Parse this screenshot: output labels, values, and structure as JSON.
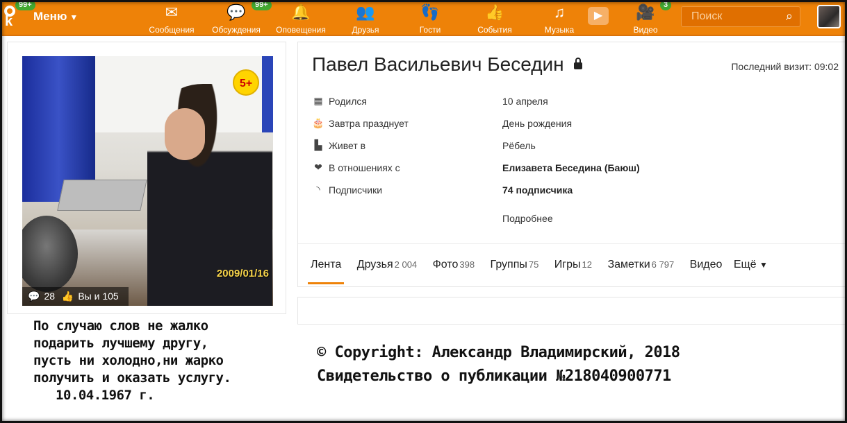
{
  "topbar": {
    "logo_badge": "99+",
    "menu_label": "Меню",
    "nav": [
      {
        "label": "Сообщения",
        "icon": "envelope-icon"
      },
      {
        "label": "Обсуждения",
        "icon": "chat-icon",
        "badge": "99+"
      },
      {
        "label": "Оповещения",
        "icon": "bell-icon"
      },
      {
        "label": "Друзья",
        "icon": "friends-icon"
      },
      {
        "label": "Гости",
        "icon": "footprints-icon"
      },
      {
        "label": "События",
        "icon": "events-icon"
      },
      {
        "label": "Музыка",
        "icon": "music-icon"
      },
      {
        "label": "Видео",
        "icon": "video-camera-icon",
        "badge": "3"
      }
    ],
    "search_placeholder": "Поиск"
  },
  "photo": {
    "date_stamp": "2009/01/16",
    "age_badge": "5+",
    "comments": "28",
    "likes": "Вы и 105"
  },
  "profile": {
    "name": "Павел Васильевич Беседин",
    "last_visit": "Последний визит: 09:02",
    "rows": [
      {
        "key": "Родился",
        "value": "10 апреля",
        "icon": "calendar-icon",
        "bold": false
      },
      {
        "key": "Завтра празднует",
        "value": "День рождения",
        "icon": "cake-icon",
        "bold": false
      },
      {
        "key": "Живет в",
        "value": "Рёбель",
        "icon": "city-icon",
        "bold": false
      },
      {
        "key": "В отношениях с",
        "value": "Елизавета Беседина (Баюш)",
        "icon": "hearts-icon",
        "bold": true
      },
      {
        "key": "Подписчики",
        "value": "74 подписчика",
        "icon": "rss-icon",
        "bold": true
      }
    ],
    "more_link": "Подробнее",
    "tabs": [
      {
        "label": "Лента",
        "count": ""
      },
      {
        "label": "Друзья",
        "count": "2 004"
      },
      {
        "label": "Фото",
        "count": "398"
      },
      {
        "label": "Группы",
        "count": "75"
      },
      {
        "label": "Игры",
        "count": "12"
      },
      {
        "label": "Заметки",
        "count": "6 797"
      },
      {
        "label": "Видео",
        "count": ""
      }
    ],
    "more_tab": "Ещё"
  },
  "poem": {
    "lines": [
      "По случаю слов не жалко",
      "подарить лучшему другу,",
      "пусть ни холодно,ни жарко",
      "получить и оказать услугу."
    ],
    "date": "10.04.1967 г."
  },
  "copyright": {
    "line1": "© Copyright: Александр Владимирский, 2018",
    "line2": "Свидетельство о публикации №218040900771"
  },
  "colors": {
    "accent": "#ee8208",
    "badge": "#42a831",
    "age_badge_bg": "#ffd400",
    "date_stamp": "#f6d34a"
  }
}
